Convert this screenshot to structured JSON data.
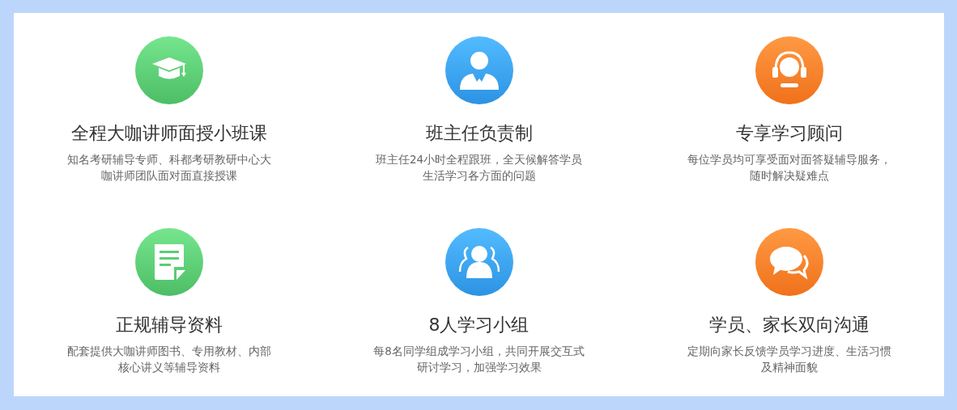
{
  "features": [
    {
      "color": "#5ccd74",
      "title": "全程大咖讲师面授小班课",
      "description": [
        "知名考研辅导专师、科都考研教研中心大",
        "咖讲师团队面对面直接授课"
      ]
    },
    {
      "color": "#3aa2f2",
      "title": "班主任负责制",
      "description": [
        "班主任24小时全程跟班，全天候解答学员",
        "生活学习各方面的问题"
      ]
    },
    {
      "color": "#ff802a",
      "title": "专享学习顾问",
      "description": [
        "每位学员均可享受面对面答疑辅导服务，",
        "随时解决疑难点"
      ]
    },
    {
      "color": "#5ccd74",
      "title": "正规辅导资料",
      "description": [
        "配套提供大咖讲师图书、专用教材、内部",
        "核心讲义等辅导资料"
      ]
    },
    {
      "color": "#3aa2f2",
      "title": "8人学习小组",
      "description": [
        "每8名同学组成学习小组，共同开展交互式",
        "研讨学习，加强学习效果"
      ]
    },
    {
      "color": "#ff802a",
      "title": "学员、家长双向沟通",
      "description": [
        "定期向家长反馈学员学习进度、生活习惯",
        "及精神面貌"
      ]
    }
  ]
}
